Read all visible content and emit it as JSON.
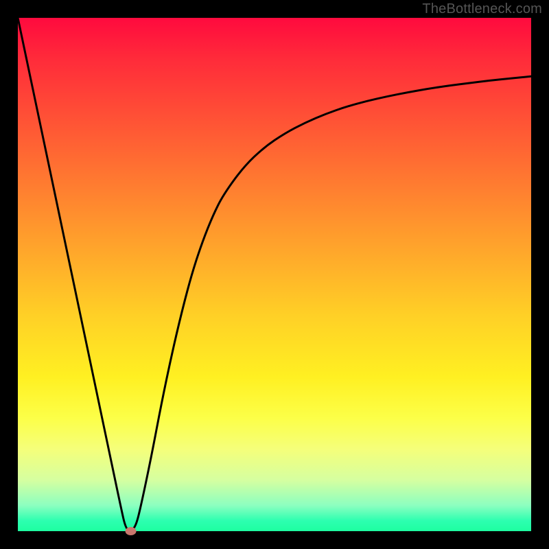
{
  "attribution": "TheBottleneck.com",
  "colors": {
    "frame": "#000000",
    "gradient_top": "#ff0a3e",
    "gradient_bottom": "#1effa0",
    "curve": "#000000",
    "marker": "#c9776d"
  },
  "chart_data": {
    "type": "line",
    "title": "",
    "xlabel": "",
    "ylabel": "",
    "xlim": [
      0,
      100
    ],
    "ylim": [
      0,
      100
    ],
    "x": [
      0,
      2,
      4,
      6,
      8,
      10,
      12,
      14,
      16,
      18,
      20,
      21,
      22,
      23,
      24,
      26,
      28,
      30,
      32,
      34,
      36,
      38,
      40,
      44,
      48,
      52,
      56,
      60,
      64,
      68,
      72,
      76,
      80,
      84,
      88,
      92,
      96,
      100
    ],
    "values": [
      100,
      90.5,
      81.0,
      71.5,
      62.0,
      52.5,
      43.0,
      33.5,
      24.0,
      14.5,
      5.0,
      0.5,
      0.0,
      1.0,
      5.0,
      14.5,
      25.0,
      34.5,
      43.0,
      50.5,
      56.5,
      61.5,
      65.5,
      71.0,
      74.8,
      77.5,
      79.6,
      81.3,
      82.7,
      83.8,
      84.7,
      85.5,
      86.2,
      86.8,
      87.3,
      87.8,
      88.2,
      88.6
    ],
    "marker": {
      "x": 22,
      "y": 0
    },
    "annotations": []
  }
}
